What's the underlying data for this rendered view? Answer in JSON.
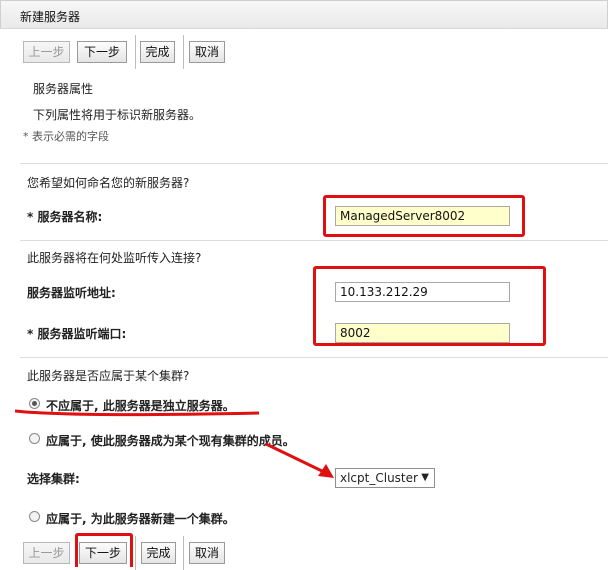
{
  "window": {
    "title": "新建服务器"
  },
  "toolbar": {
    "back": "上一步",
    "next": "下一步",
    "finish": "完成",
    "cancel": "取消"
  },
  "section": {
    "heading": "服务器属性",
    "description": "下列属性将用于标识新服务器。",
    "required_note": "* 表示必需的字段"
  },
  "name_group": {
    "question": "您希望如何命名您的新服务器?",
    "label": "* 服务器名称:",
    "value": "ManagedServer8002"
  },
  "listen_group": {
    "question": "此服务器将在何处监听传入连接?",
    "address_label": "服务器监听地址:",
    "address_value": "10.133.212.29",
    "port_label": "* 服务器监听端口:",
    "port_value": "8002"
  },
  "cluster_group": {
    "question": "此服务器是否应属于某个集群?",
    "option_standalone": "不应属于, 此服务器是独立服务器。",
    "option_existing": "应属于, 使此服务器成为某个现有集群的成员。",
    "select_label": "选择集群:",
    "select_value": "xlcpt_Cluster",
    "option_new": "应属于, 为此服务器新建一个集群。",
    "selected_option": "standalone"
  },
  "colors": {
    "annotation_red": "#e01010",
    "required_field_bg": "#ffffcc"
  }
}
